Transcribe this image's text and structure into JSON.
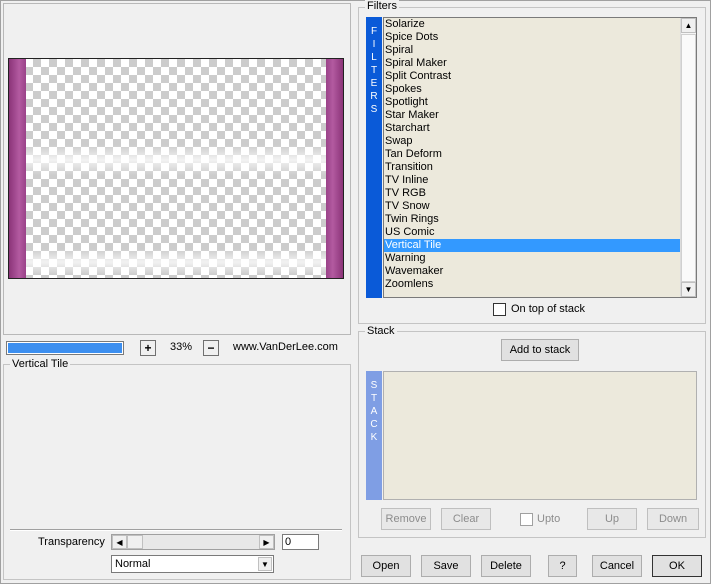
{
  "preview": {
    "zoom": "33%",
    "zoom_in": "+",
    "zoom_out": "−",
    "website": "www.VanDerLee.com",
    "progress_fraction": 0.98
  },
  "settings": {
    "title": "Vertical Tile",
    "transparency_label": "Transparency",
    "transparency_value": "0",
    "blend_mode": "Normal"
  },
  "filters": {
    "title": "Filters",
    "side_label": [
      "F",
      "I",
      "L",
      "T",
      "E",
      "R",
      "S"
    ],
    "items": [
      "Solarize",
      "Spice Dots",
      "Spiral",
      "Spiral Maker",
      "Split Contrast",
      "Spokes",
      "Spotlight",
      "Star Maker",
      "Starchart",
      "Swap",
      "Tan Deform",
      "Transition",
      "TV Inline",
      "TV RGB",
      "TV Snow",
      "Twin Rings",
      "US Comic",
      "Vertical Tile",
      "Warning",
      "Wavemaker",
      "Zoomlens"
    ],
    "selected": "Vertical Tile",
    "on_top_label": "On top of stack"
  },
  "stack": {
    "title": "Stack",
    "add_label": "Add to stack",
    "side_label": [
      "S",
      "T",
      "A",
      "C",
      "K"
    ],
    "remove_label": "Remove",
    "clear_label": "Clear",
    "upto_label": "Upto",
    "up_label": "Up",
    "down_label": "Down"
  },
  "buttons": {
    "open": "Open",
    "save": "Save",
    "delete": "Delete",
    "help": "?",
    "cancel": "Cancel",
    "ok": "OK"
  },
  "colors": {
    "accent": "#3399ff",
    "filters_bar": "#0a5ad8",
    "stack_bar": "#7f9ee4",
    "list_bg": "#ece9dc",
    "preview_edge": "#b35aa0"
  }
}
